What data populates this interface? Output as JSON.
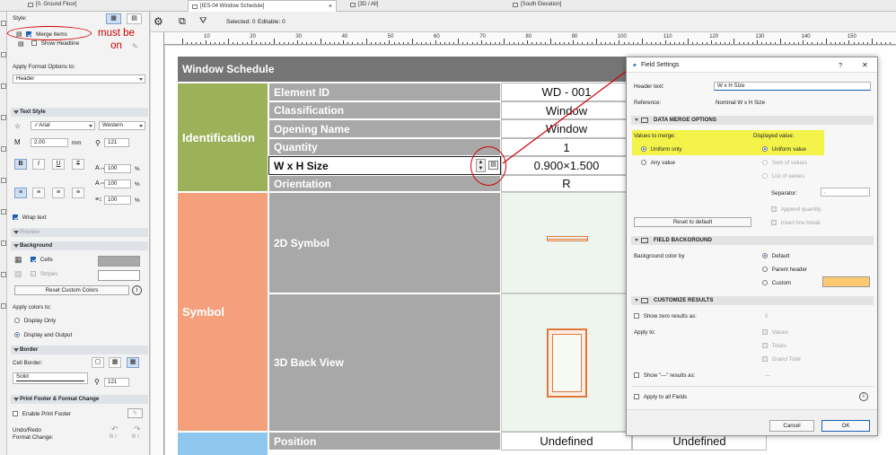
{
  "tabs": [
    {
      "label": "[0. Ground Floor]"
    },
    {
      "label": "[IES-04 Window Schedule]",
      "active": true
    },
    {
      "label": "[3D / All]"
    },
    {
      "label": "[South Elevation]"
    }
  ],
  "view_toolbar": {
    "selected": "Selected: 0",
    "editable": "Editable: 0"
  },
  "ruler_ticks": [
    "10",
    "20",
    "30",
    "40",
    "50",
    "60",
    "70",
    "80",
    "90",
    "100",
    "110",
    "120",
    "130",
    "140",
    "150"
  ],
  "panel": {
    "style_label": "Style:",
    "merge_items": "Merge items",
    "show_headline": "Show Headline",
    "annotation": [
      "must be",
      "on"
    ],
    "apply_format_label": "Apply Format Options to:",
    "apply_format_value": "Header",
    "text_style": "Text Style",
    "font": "Arial",
    "script": "Western",
    "size": "2.00",
    "size_unit": "mm",
    "pen": "121",
    "bold": "B",
    "italic": "I",
    "underline": "U",
    "strike": "T",
    "width_pct": "100",
    "spacing_pct": "100",
    "height_pct": "100",
    "pct": "%",
    "wrap_text": "Wrap text",
    "preview": "Preview",
    "background": "Background",
    "cells": "Cells",
    "stripes": "Stripes",
    "reset_colors": "Reset Custom Colors",
    "info": "i",
    "apply_colors_label": "Apply colors to:",
    "display_only": "Display Only",
    "display_output": "Display and Output",
    "border": "Border",
    "cell_border": "Cell Border:",
    "border_line": "Solid",
    "border_pen": "121",
    "print_footer": "Print Footer & Format Change",
    "enable_footer": "Enable Print Footer",
    "undo_redo": "Undo/Redo",
    "format_change": "Format Change:",
    "undo_hint": "B /",
    "redo_hint": "B /"
  },
  "schedule": {
    "title": "Window Schedule",
    "groups": {
      "identification": "Identification",
      "symbol": "Symbol"
    },
    "rows": [
      {
        "label": "Element ID",
        "value": "WD - 001"
      },
      {
        "label": "Classification",
        "value": "Window"
      },
      {
        "label": "Opening Name",
        "value": "Window"
      },
      {
        "label": "Quantity",
        "value": "1"
      },
      {
        "label": "W x H Size",
        "value": "0.900×1.500"
      },
      {
        "label": "Orientation",
        "value": "R"
      }
    ],
    "symbol_rows": [
      {
        "label": "2D Symbol"
      },
      {
        "label": "3D Back View"
      }
    ],
    "bottom_row": {
      "label": "Position",
      "value": "Undefined",
      "value2": "Undefined"
    },
    "colors": {
      "header": "#757575",
      "identification": "#9bb15a",
      "symbol": "#f4a07c",
      "label_col": "#a8a8a8",
      "selected_row": "#c6dbf3",
      "position_group": "#8ec6f0",
      "symbol_cell": "#eef5ee",
      "annotation": "#d00000"
    }
  },
  "dialog": {
    "title": "Field Settings",
    "help": "?",
    "close": "✕",
    "header_text_label": "Header text:",
    "header_text_value": "W x H Size",
    "reference_label": "Reference:",
    "reference_value": "Nominal W x H Size",
    "merge_section": "DATA MERGE OPTIONS",
    "values_to_merge": "Values to merge:",
    "uniform_only": "Uniform only",
    "any_value": "Any value",
    "displayed_value": "Displayed value:",
    "uniform_value": "Uniform value",
    "sum_values": "Sum of values",
    "list_values": "List of values",
    "separator_label": "Separator:",
    "separator_value": ",",
    "append_quantity": "Append quantity",
    "insert_line_break": "Insert line break",
    "reset_default": "Reset to default",
    "background_section": "FIELD BACKGROUND",
    "bg_color_label": "Background color by",
    "bg_default": "Default",
    "bg_parent": "Parent header",
    "bg_custom": "Custom",
    "custom_color": "#fcc870",
    "highlight_color": "#f3f34a",
    "results_section": "CUSTOMIZE RESULTS",
    "show_zero": "Show zero results as:",
    "zero_value": "0",
    "apply_to": "Apply to:",
    "values": "Values",
    "totals": "Totals",
    "grand_total": "Grand Total",
    "show_dash": "Show \"---\" results as:",
    "dash_value": "---",
    "apply_all": "Apply to all Fields",
    "info": "i",
    "cancel": "Cancel",
    "ok": "OK"
  }
}
